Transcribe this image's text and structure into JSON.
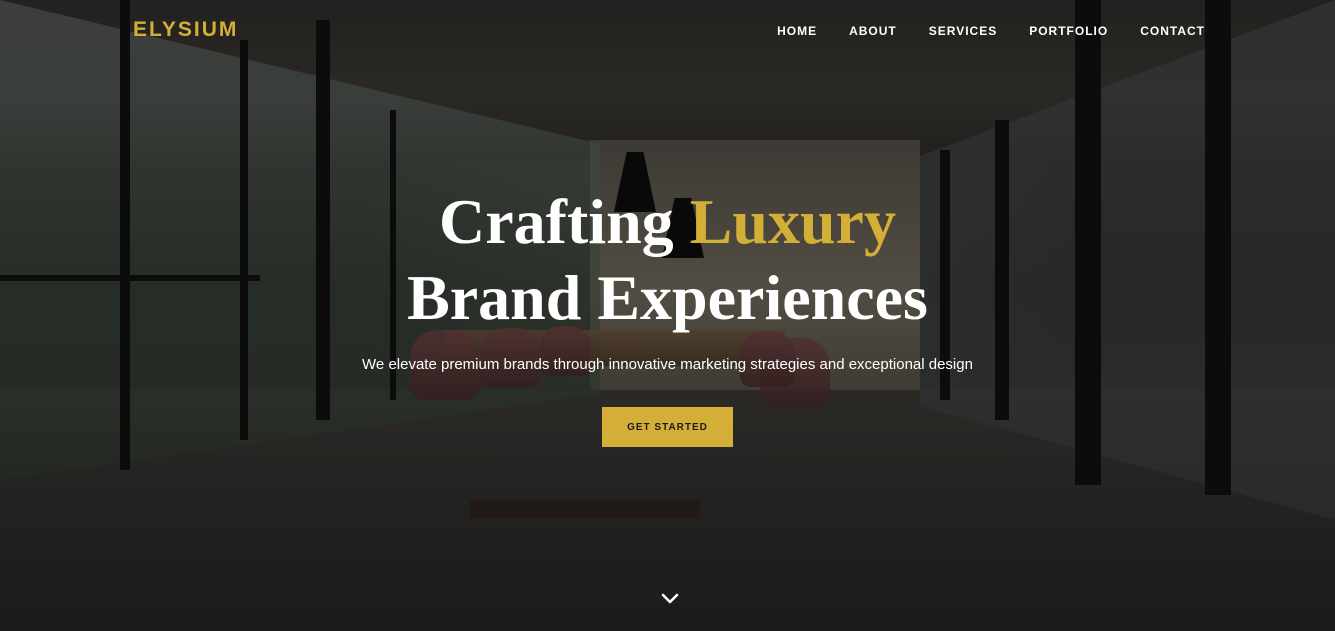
{
  "brand": {
    "logo_text": "ELYSIUM"
  },
  "nav": {
    "items": [
      {
        "label": "HOME"
      },
      {
        "label": "ABOUT"
      },
      {
        "label": "SERVICES"
      },
      {
        "label": "PORTFOLIO"
      },
      {
        "label": "CONTACT"
      }
    ]
  },
  "hero": {
    "title_line1_plain": "Crafting ",
    "title_line1_accent": "Luxury",
    "title_line2": "Brand Experiences",
    "subtitle": "We elevate premium brands through innovative marketing strategies and exceptional design",
    "cta_label": "GET STARTED",
    "scroll_icon": "chevron-down-icon"
  },
  "colors": {
    "accent": "#d4af37",
    "text": "#ffffff",
    "overlay": "rgba(0,0,0,0.42)"
  }
}
